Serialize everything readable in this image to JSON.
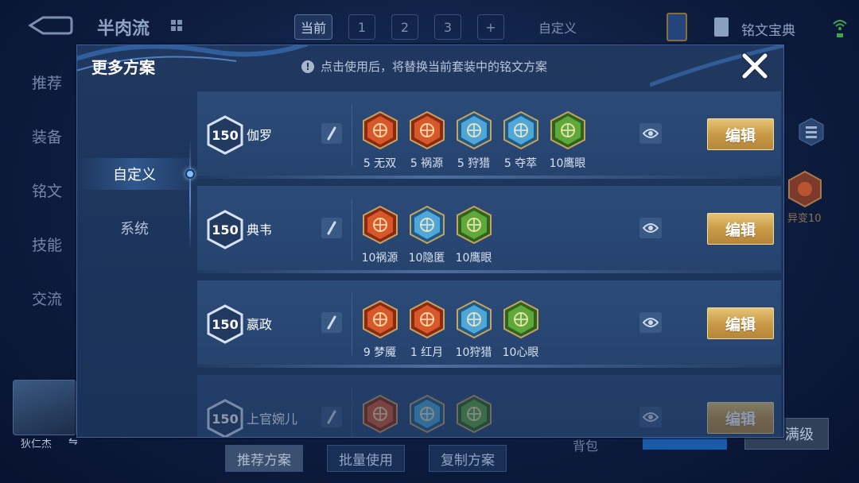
{
  "background": {
    "title": "半肉流",
    "page_tabs": [
      "当前",
      "1",
      "2",
      "3",
      "+"
    ],
    "custom_tab": "自定义",
    "codex_label": "铭文宝典",
    "side_nav": [
      "推荐",
      "装备",
      "铭文",
      "技能",
      "交流"
    ],
    "hero_name": "狄仁杰",
    "bottom_buttons": [
      "推荐方案",
      "批量使用",
      "复制方案"
    ],
    "backpack": "背包",
    "max_level": "满级",
    "rune_side_label": "异变10"
  },
  "modal": {
    "title": "更多方案",
    "hint": "点击使用后，将替换当前套装中的铭文方案",
    "tabs": [
      "自定义",
      "系统"
    ],
    "active_tab": "自定义",
    "edit_label": "编辑"
  },
  "plans": [
    {
      "level": "150",
      "hero": "伽罗",
      "runes": [
        {
          "label": "5 无双",
          "icon": "wushuang-rune-icon",
          "color": "#d9582a"
        },
        {
          "label": "5 祸源",
          "icon": "huoyuan-rune-icon",
          "color": "#d9582a"
        },
        {
          "label": "5 狩猎",
          "icon": "shoulie-rune-icon",
          "color": "#4fa6d8"
        },
        {
          "label": "5 夺萃",
          "icon": "duocui-rune-icon",
          "color": "#4fa6d8"
        },
        {
          "label": "10鹰眼",
          "icon": "yingyan-rune-icon",
          "color": "#5fa83a"
        }
      ]
    },
    {
      "level": "150",
      "hero": "典韦",
      "runes": [
        {
          "label": "10祸源",
          "icon": "huoyuan-rune-icon",
          "color": "#d9582a"
        },
        {
          "label": "10隐匿",
          "icon": "yinni-rune-icon",
          "color": "#4fa6d8"
        },
        {
          "label": "10鹰眼",
          "icon": "yingyan-rune-icon",
          "color": "#5fa83a"
        }
      ]
    },
    {
      "level": "150",
      "hero": "嬴政",
      "runes": [
        {
          "label": "9 梦魇",
          "icon": "mengyan-rune-icon",
          "color": "#d9582a"
        },
        {
          "label": "1 红月",
          "icon": "hongyue-rune-icon",
          "color": "#d9582a"
        },
        {
          "label": "10狩猎",
          "icon": "shoulie-rune-icon",
          "color": "#4fa6d8"
        },
        {
          "label": "10心眼",
          "icon": "xinyan-rune-icon",
          "color": "#5fa83a"
        }
      ]
    },
    {
      "level": "150",
      "hero": "上官婉儿",
      "runes": [
        {
          "label": "",
          "icon": "mengyan-rune-icon",
          "color": "#d9582a"
        },
        {
          "label": "",
          "icon": "shoulie-rune-icon",
          "color": "#4fa6d8"
        },
        {
          "label": "",
          "icon": "xinyan-rune-icon",
          "color": "#5fa83a"
        }
      ]
    }
  ]
}
